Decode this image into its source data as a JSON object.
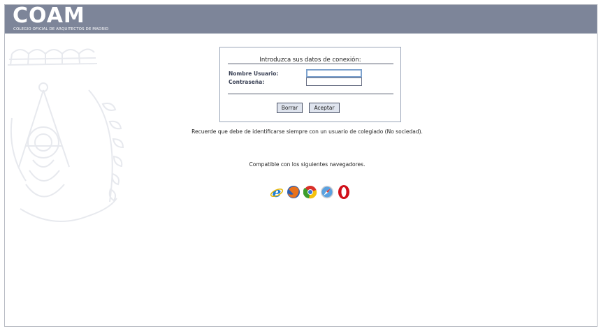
{
  "header": {
    "logo_text": "COAM",
    "logo_subtitle": "COLEGIO OFICIAL DE ARQUITECTOS DE MADRID",
    "background": "#7d8599"
  },
  "login": {
    "title": "Introduzca sus datos de conexión:",
    "username_label": "Nombre Usuario:",
    "username_value": "",
    "password_label": "Contraseña:",
    "password_value": "",
    "clear_button": "Borrar",
    "submit_button": "Aceptar"
  },
  "notice": "Recuerde que debe de identificarse siempre con un usuario de colegiado (No sociedad).",
  "compat": {
    "text": "Compatible con los siguientes navegadores.",
    "browsers": [
      {
        "name": "internet-explorer",
        "color": "#1f7fd6"
      },
      {
        "name": "firefox",
        "color": "#e8711c"
      },
      {
        "name": "chrome",
        "color": "#3c9d2c"
      },
      {
        "name": "safari",
        "color": "#5aa2e0"
      },
      {
        "name": "opera",
        "color": "#d0101a"
      }
    ]
  }
}
